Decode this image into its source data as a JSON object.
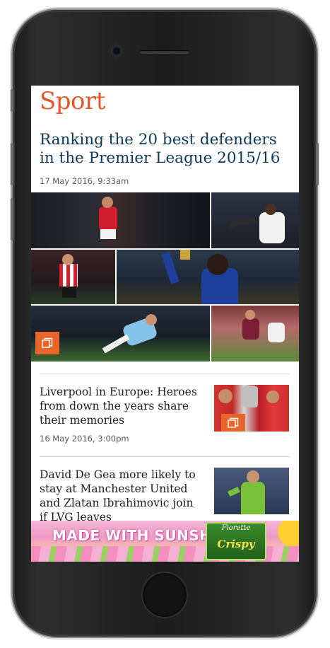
{
  "section": {
    "title": "Sport"
  },
  "lead": {
    "headline": "Ranking the 20 best defenders in the Premier League 2015/16",
    "date": "17 May 2016, 9:33am"
  },
  "stories": [
    {
      "title": "Liverpool in Europe: Heroes from down the years share their memories",
      "date": "16 May 2016, 3:00pm",
      "has_gallery": true
    },
    {
      "title": "David De Gea more likely to stay at Manchester United and Zlatan Ibrahimovic join if LVG leaves",
      "date": ""
    }
  ],
  "ad": {
    "headline": "MADE WITH SUNSHINE",
    "brand": "Florette",
    "product": "Crispy"
  },
  "colors": {
    "accent": "#e3582b",
    "headline": "#0f3a57",
    "gallery_badge": "#e8662b"
  },
  "icons": {
    "gallery": "gallery-icon"
  }
}
